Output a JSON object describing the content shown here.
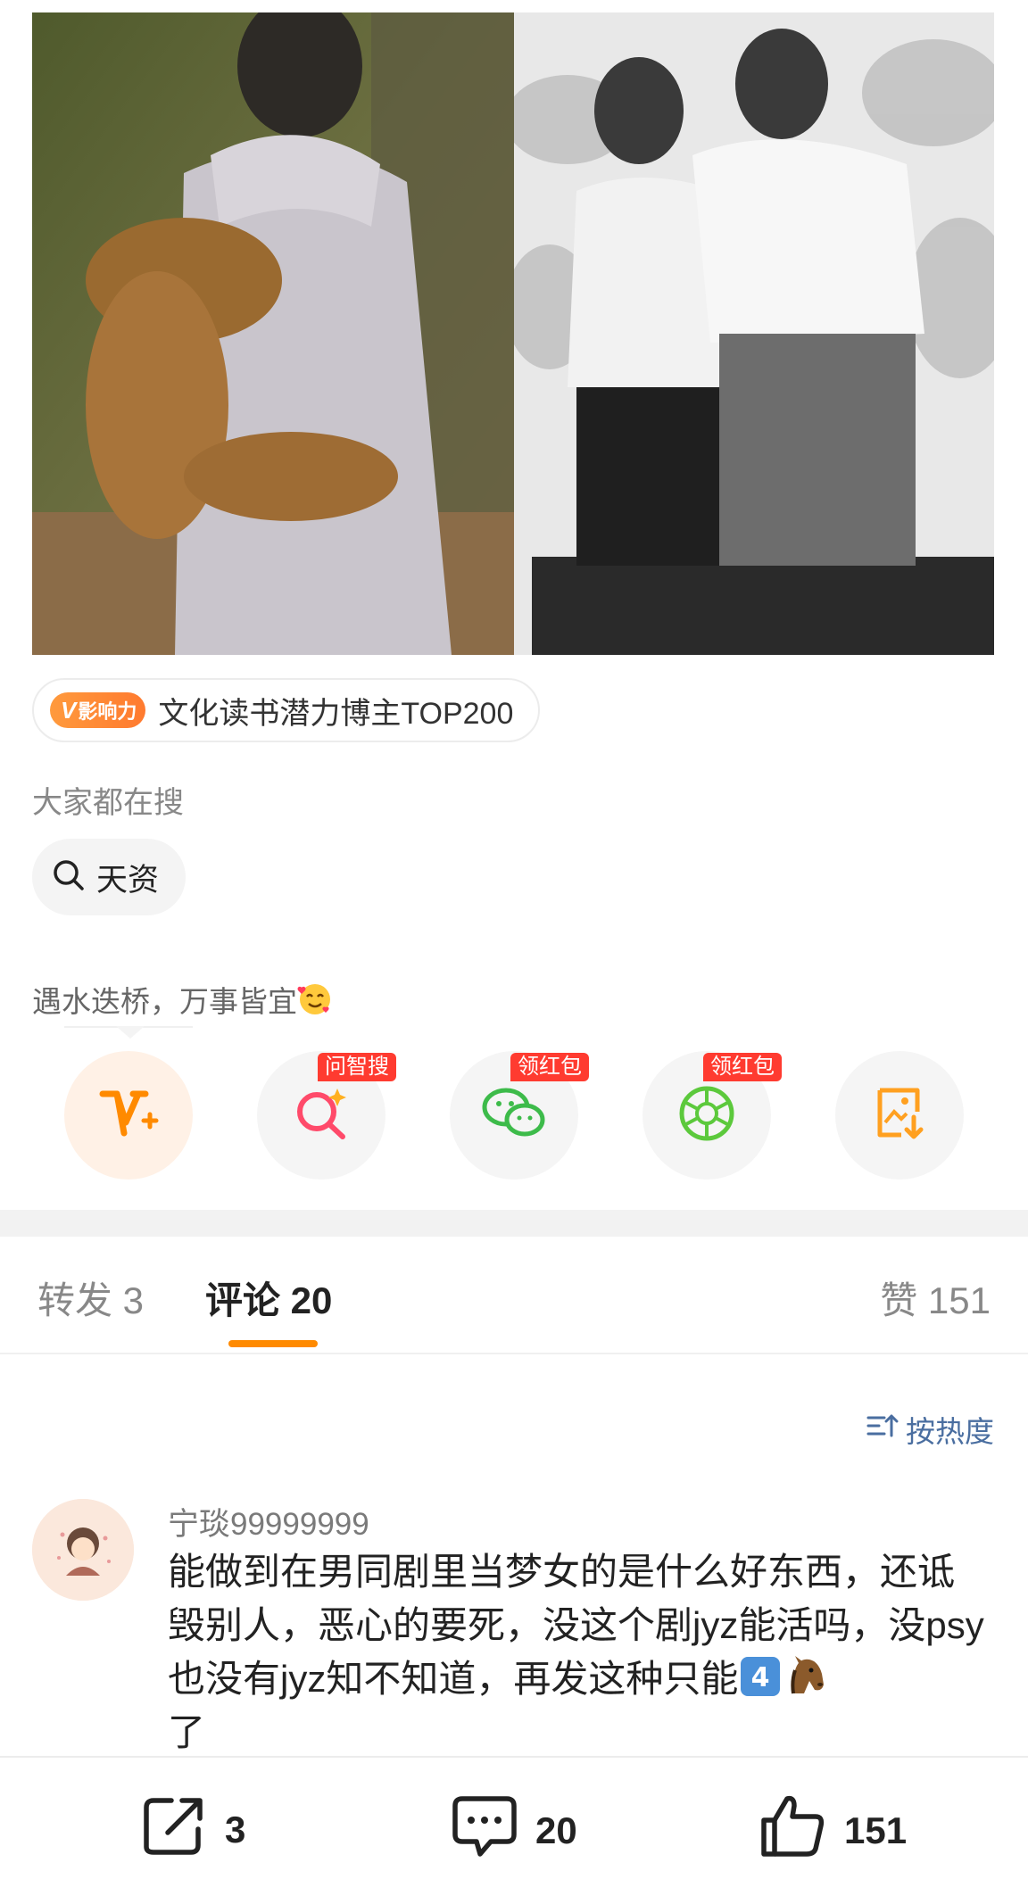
{
  "influence": {
    "badge_v": "V",
    "badge_label": "影响力",
    "text": "文化读书潜力博主TOP200"
  },
  "search": {
    "heading": "大家都在搜",
    "chip_label": "天资"
  },
  "motto": "遇水迭桥，万事皆宜",
  "actions": [
    {
      "icon": "v-plus-icon",
      "badge": ""
    },
    {
      "icon": "ai-search-icon",
      "badge": "问智搜"
    },
    {
      "icon": "wechat-icon",
      "badge": "领红包"
    },
    {
      "icon": "moments-icon",
      "badge": "领红包"
    },
    {
      "icon": "save-image-icon",
      "badge": ""
    }
  ],
  "tabs": {
    "reposts": "转发 3",
    "comments": "评论 20",
    "likes": "赞 151"
  },
  "sort_label": "按热度",
  "comment": {
    "username": "宁琰99999999",
    "text": "能做到在男同剧里当梦女的是什么好东西，还诋毁别人，恶心的要死，没这个剧jyz能活吗，没psy也没有jyz知不知道，再发这种只能",
    "text_end": "了"
  },
  "bottom_bar": {
    "repost_count": "3",
    "comment_count": "20",
    "like_count": "151"
  },
  "colors": {
    "accent_orange": "#ff8a00",
    "badge_red": "#ff3b30",
    "link_blue": "#4a6ea0"
  }
}
